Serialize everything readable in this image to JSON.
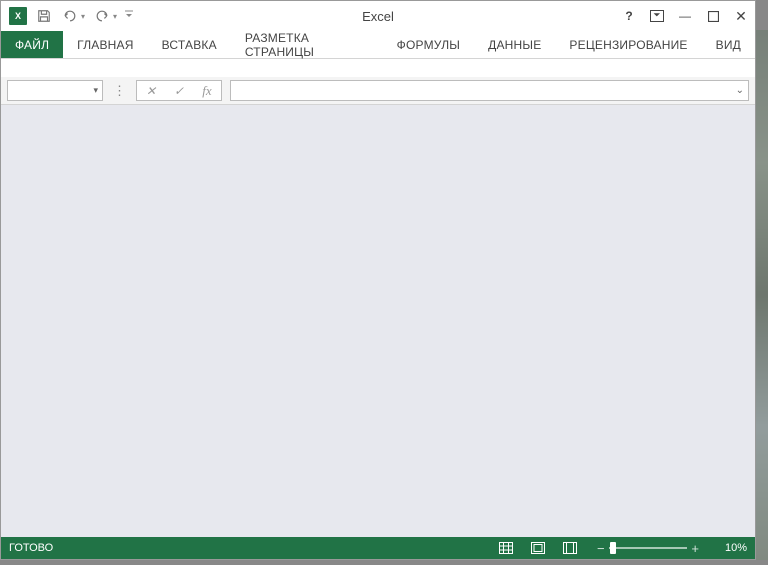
{
  "app": {
    "title": "Excel"
  },
  "tabs": [
    {
      "label": "ФАЙЛ",
      "active": true
    },
    {
      "label": "ГЛАВНАЯ"
    },
    {
      "label": "ВСТАВКА"
    },
    {
      "label": "РАЗМЕТКА СТРАНИЦЫ"
    },
    {
      "label": "ФОРМУЛЫ"
    },
    {
      "label": "ДАННЫЕ"
    },
    {
      "label": "РЕЦЕНЗИРОВАНИЕ"
    },
    {
      "label": "ВИД"
    }
  ],
  "name_box": {
    "value": ""
  },
  "formula_bar": {
    "value": "",
    "fx_label": "fx",
    "cancel": "✕",
    "enter": "✓"
  },
  "status": {
    "ready": "ГОТОВО",
    "zoom": "10%"
  },
  "icons": {
    "save": "💾",
    "undo": "↶",
    "redo": "↷",
    "help": "?",
    "ribbon_opts": "▣",
    "minimize": "—",
    "maximize": "☐",
    "close": "✕",
    "caret_down": "▾",
    "qat_custom": "▾",
    "vdots": "⋮",
    "expand": "⌄",
    "view_normal": "▦",
    "view_layout": "▥",
    "view_break": "▤",
    "zoom_out": "−",
    "zoom_in": "+"
  }
}
